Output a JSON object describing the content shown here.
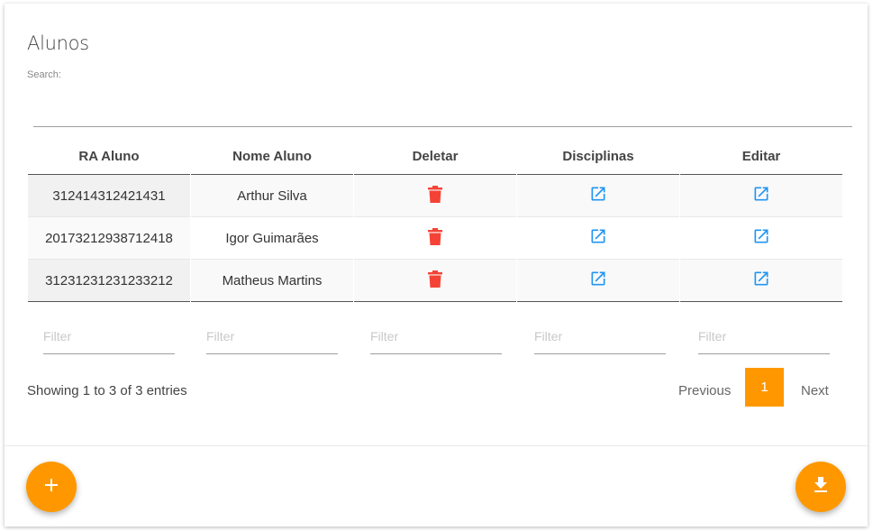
{
  "page": {
    "title": "Alunos"
  },
  "search": {
    "label": "Search:",
    "value": ""
  },
  "table": {
    "columns": [
      "RA Aluno",
      "Nome Aluno",
      "Deletar",
      "Disciplinas",
      "Editar"
    ],
    "rows": [
      {
        "ra": "312414312421431",
        "nome": "Arthur Silva"
      },
      {
        "ra": "20173212938712418",
        "nome": "Igor Guimarães"
      },
      {
        "ra": "31231231231233212",
        "nome": "Matheus Martins"
      }
    ],
    "filter_placeholder": "Filter"
  },
  "pagination": {
    "info": "Showing 1 to 3 of 3 entries",
    "previous": "Previous",
    "current": "1",
    "next": "Next"
  },
  "icons": {
    "delete": "trash-icon",
    "open": "open-in-new-icon",
    "add": "plus-icon",
    "download": "download-icon"
  },
  "colors": {
    "accent": "#ff9800",
    "delete": "#f44336",
    "link": "#2196f3"
  }
}
